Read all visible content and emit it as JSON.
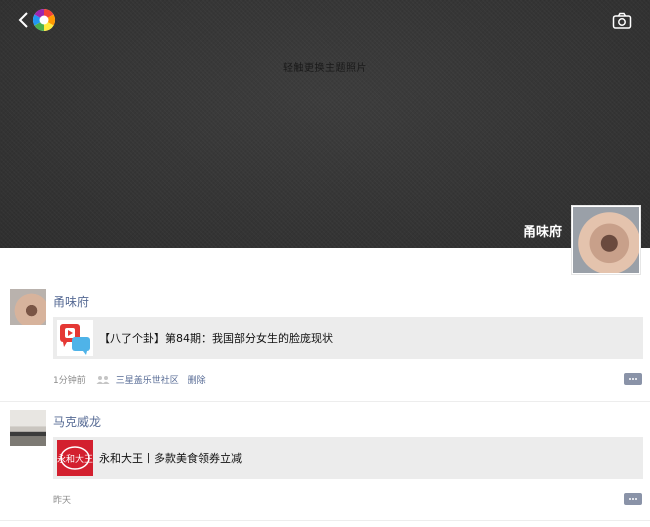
{
  "cover": {
    "hint": "轻触更换主题照片",
    "profile_name": "甬味府"
  },
  "icons": {
    "back": "back-chevron-icon",
    "app": "app-logo-icon",
    "camera": "camera-icon",
    "people": "people-icon",
    "comment": "comment-more-icon"
  },
  "colors": {
    "link": "#576b95",
    "cover": "#343434",
    "card": "#ececec"
  },
  "posts": [
    {
      "author": "甬味府",
      "card_title": "【八了个卦】第84期：我国部分女生的脸庞现状",
      "time": "1分钟前",
      "location": "三星盖乐世社区",
      "delete": "删除"
    },
    {
      "author": "马克威龙",
      "card_title": "永和大王丨多款美食领券立减",
      "thumb_text": "永和大王",
      "time": "昨天"
    }
  ]
}
